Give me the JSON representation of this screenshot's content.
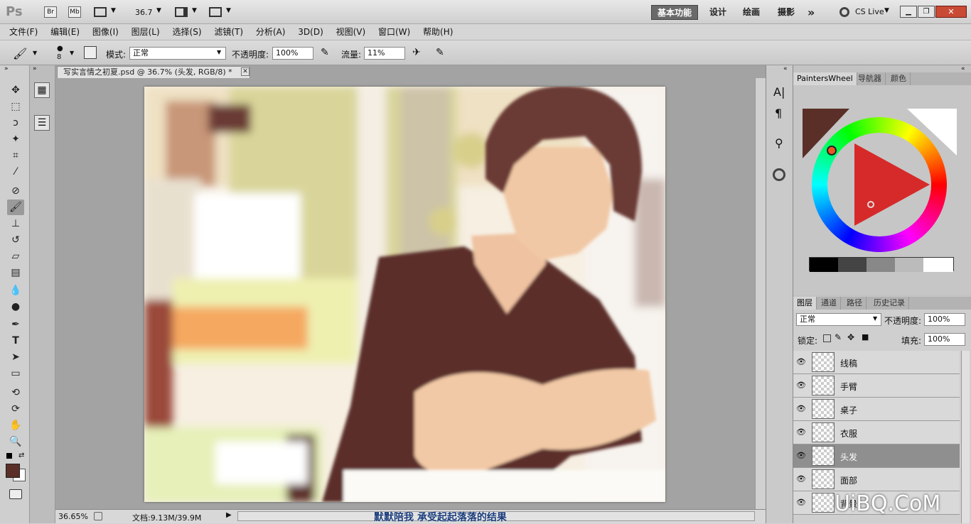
{
  "app": {
    "logo": "Ps",
    "br": "Br",
    "mb": "Mb",
    "zoom": "36.7"
  },
  "workspace": {
    "items": [
      "基本功能",
      "设计",
      "绘画",
      "摄影"
    ],
    "active": 0,
    "more": "»",
    "cslive": "CS Live"
  },
  "menu": [
    "文件(F)",
    "编辑(E)",
    "图像(I)",
    "图层(L)",
    "选择(S)",
    "滤镜(T)",
    "分析(A)",
    "3D(D)",
    "视图(V)",
    "窗口(W)",
    "帮助(H)"
  ],
  "options": {
    "brush_size": "8",
    "mode_label": "模式:",
    "mode_value": "正常",
    "opacity_label": "不透明度:",
    "opacity_value": "100%",
    "flow_label": "流量:",
    "flow_value": "11%"
  },
  "document": {
    "tab_title": "写实言情之初夏.psd @ 36.7% (头发, RGB/8) *",
    "close": "✕"
  },
  "status": {
    "zoom": "36.65%",
    "doc_info": "文档:9.13M/39.9M",
    "subtitle": "默默陪我 承受起起落落的结果"
  },
  "color_panel": {
    "tabs": [
      "PaintersWheel",
      "导航器",
      "颜色"
    ],
    "active": 0
  },
  "layers_panel": {
    "tabs": [
      "图层",
      "通道",
      "路径",
      "历史记录"
    ],
    "blend_mode": "正常",
    "opacity_label": "不透明度:",
    "opacity_value": "100%",
    "lock_label": "锁定:",
    "fill_label": "填充:",
    "fill_value": "100%",
    "layers": [
      "线稿",
      "手臂",
      "桌子",
      "衣服",
      "头发",
      "面部",
      "背景"
    ],
    "selected": 4
  },
  "watermark": "UiBQ.CoM",
  "colors": {
    "foreground": "#5a2f28",
    "background": "#ffffff",
    "accent": "#6a6a6a"
  }
}
